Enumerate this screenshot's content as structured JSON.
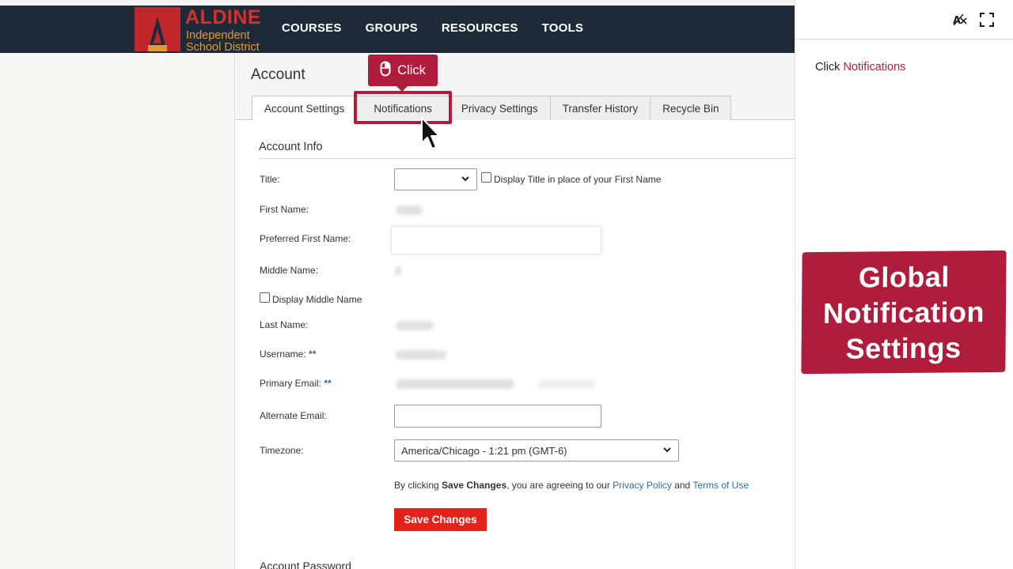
{
  "brand": {
    "name_line1": "ALDINE",
    "name_line2": "Independent",
    "name_line3": "School District"
  },
  "nav": {
    "items": [
      "COURSES",
      "GROUPS",
      "RESOURCES",
      "TOOLS"
    ]
  },
  "account": {
    "title": "Account",
    "tabs": [
      "Account Settings",
      "Notifications",
      "Privacy Settings",
      "Transfer History",
      "Recycle Bin"
    ],
    "active_tab": "Account Settings"
  },
  "form": {
    "section_title": "Account Info",
    "title_label": "Title:",
    "title_checkbox_label": "Display Title in place of your First Name",
    "first_name_label": "First Name:",
    "preferred_first_name_label": "Preferred First Name:",
    "middle_name_label": "Middle Name:",
    "middle_checkbox_label": "Display Middle Name",
    "last_name_label": "Last Name:",
    "username_label": "Username:",
    "primary_email_label": "Primary Email:",
    "required_marker": "**",
    "alternate_email_label": "Alternate Email:",
    "timezone_label": "Timezone:",
    "timezone_value": "America/Chicago - 1:21 pm (GMT-6)",
    "legal_prefix": "By clicking ",
    "legal_bold": "Save Changes",
    "legal_mid": ", you are agreeing to our ",
    "legal_privacy": "Privacy Policy",
    "legal_and": " and ",
    "legal_terms": "Terms of Use",
    "save_button": "Save Changes",
    "next_section_title": "Account Password"
  },
  "tutorial": {
    "bubble_label": "Click",
    "instruction_prefix": "Click ",
    "instruction_target": "Notifications",
    "banner_text": "Global\nNotification\nSettings"
  },
  "icons": {
    "translate": "translate-off-icon",
    "fullscreen": "fullscreen-icon",
    "mouse": "mouse-icon",
    "cursor": "cursor-arrow-icon"
  },
  "colors": {
    "nav_bg": "#1e2a38",
    "brand_red": "#c0272d",
    "brand_orange": "#e59a2d",
    "tutorial_red": "#b01d3c",
    "save_button": "#e2231a",
    "link_blue": "#2e6da4"
  }
}
